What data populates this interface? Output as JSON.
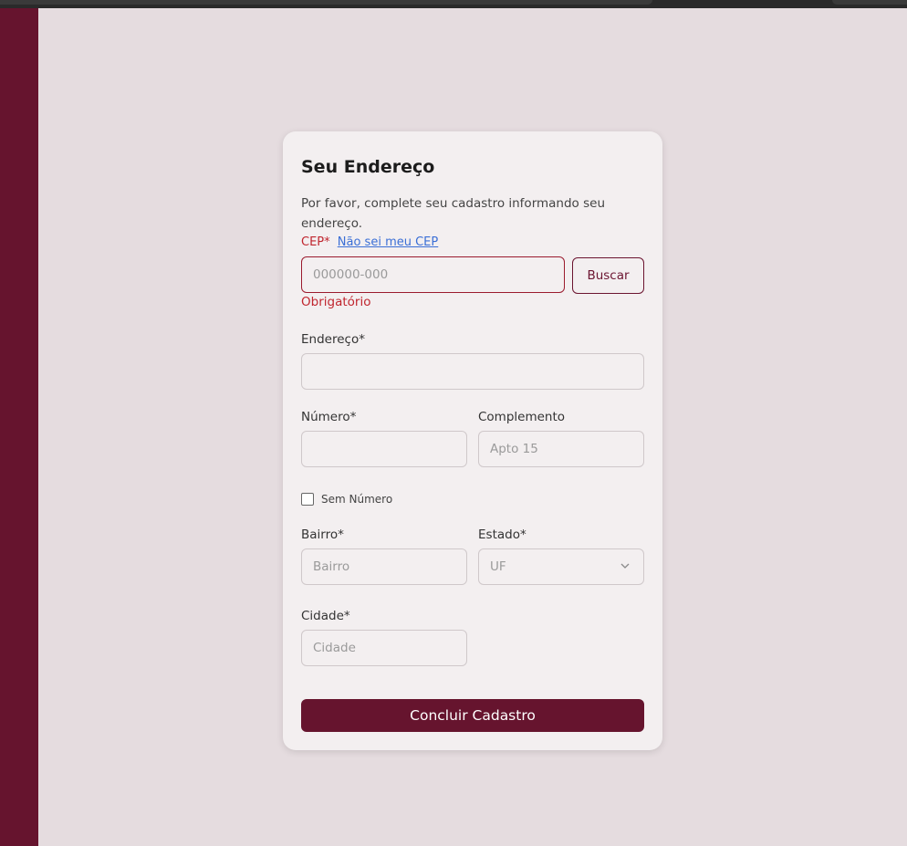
{
  "colors": {
    "primary": "#66142e",
    "error": "#c0262f",
    "link": "#3b6fd6",
    "background": "#e5dcdf",
    "card": "#f3eff0"
  },
  "form": {
    "title": "Seu Endereço",
    "description": "Por favor, complete seu cadastro informando seu endereço.",
    "cep": {
      "label": "CEP",
      "required_mark": "*",
      "help_link": "Não sei meu CEP",
      "placeholder": "000000-000",
      "value": "",
      "search_button": "Buscar",
      "error": "Obrigatório"
    },
    "endereco": {
      "label": "Endereço*",
      "placeholder": "",
      "value": ""
    },
    "numero": {
      "label": "Número*",
      "placeholder": "",
      "value": ""
    },
    "complemento": {
      "label": "Complemento",
      "placeholder": "Apto 15",
      "value": ""
    },
    "sem_numero": {
      "label": "Sem Número",
      "checked": false
    },
    "bairro": {
      "label": "Bairro*",
      "placeholder": "Bairro",
      "value": ""
    },
    "estado": {
      "label": "Estado*",
      "selected": "UF",
      "icon": "chevron-down-icon"
    },
    "cidade": {
      "label": "Cidade*",
      "placeholder": "Cidade",
      "value": ""
    },
    "submit_label": "Concluir Cadastro"
  }
}
